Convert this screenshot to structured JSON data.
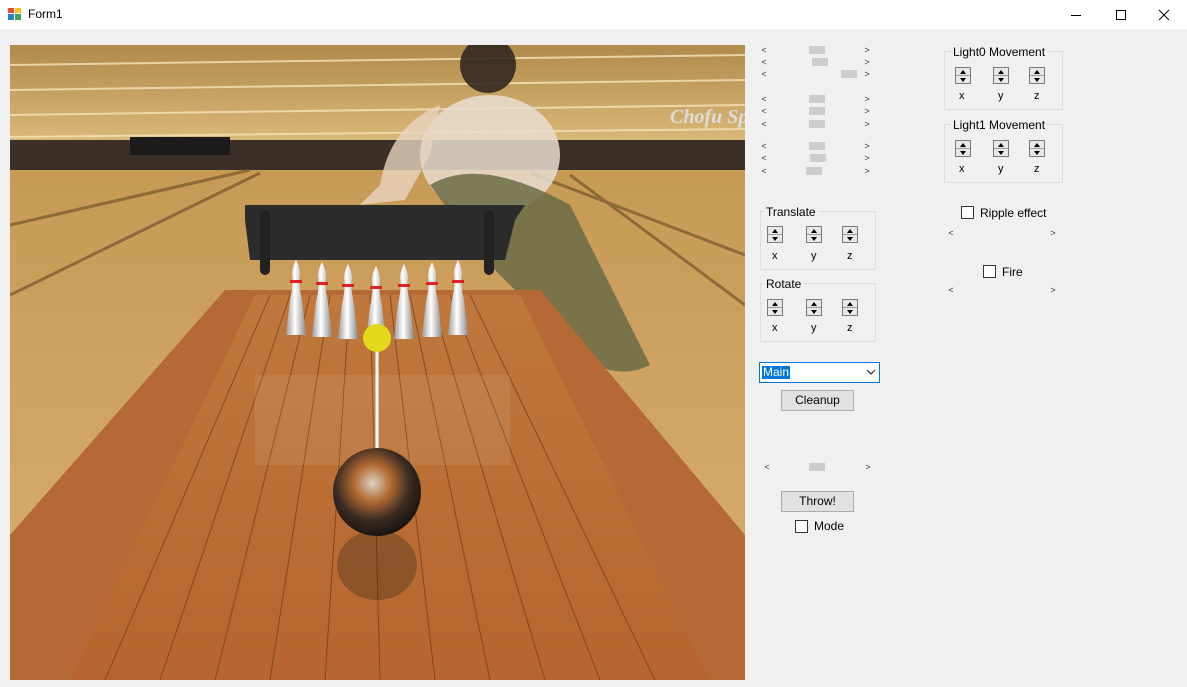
{
  "window": {
    "title": "Form1"
  },
  "light0": {
    "title": "Light0 Movement",
    "axes": [
      "x",
      "y",
      "z"
    ]
  },
  "light1": {
    "title": "Light1 Movement",
    "axes": [
      "x",
      "y",
      "z"
    ]
  },
  "translate": {
    "title": "Translate",
    "axes": [
      "x",
      "y",
      "z"
    ]
  },
  "rotate": {
    "title": "Rotate",
    "axes": [
      "x",
      "y",
      "z"
    ]
  },
  "ripple": {
    "label": "Ripple effect",
    "checked": false
  },
  "fire": {
    "label": "Fire",
    "checked": false
  },
  "camera_combo": {
    "value": "Main"
  },
  "buttons": {
    "cleanup": "Cleanup",
    "throw": "Throw!"
  },
  "mode": {
    "label": "Mode",
    "checked": false
  },
  "scene": {
    "banner_text": "Chofu Sp"
  },
  "icons": {
    "app": "form-app-icon",
    "minimize": "minimize-icon",
    "maximize": "maximize-icon",
    "close": "close-icon"
  }
}
